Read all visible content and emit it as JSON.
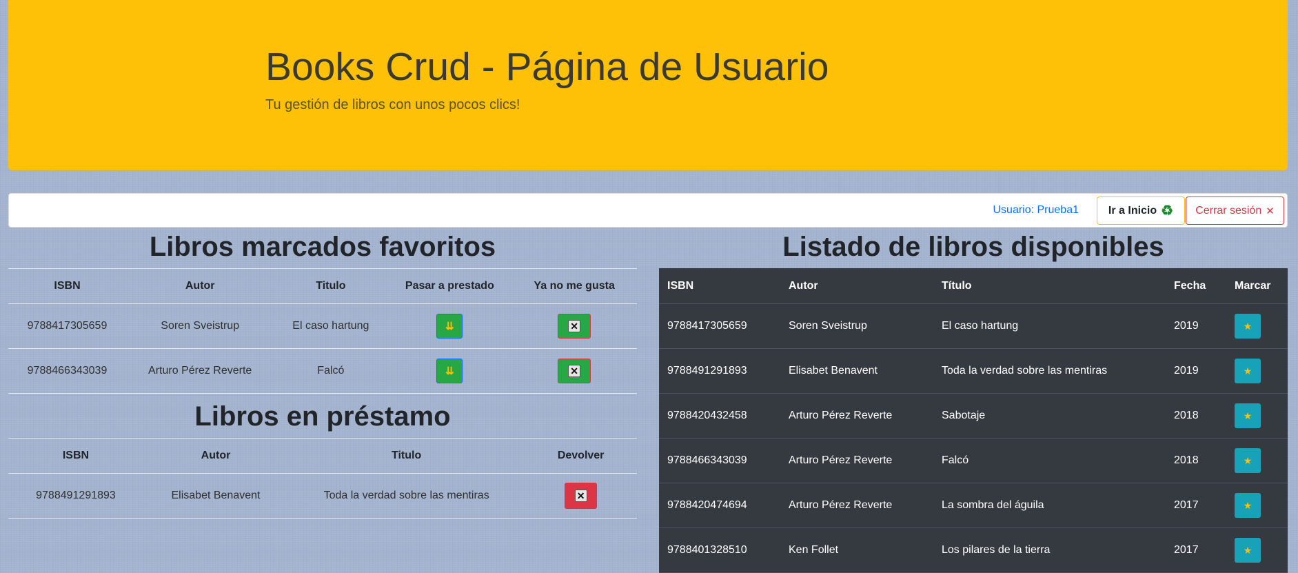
{
  "header": {
    "title": "Books Crud - Página de Usuario",
    "subtitle": "Tu gestión de libros con unos pocos clics!"
  },
  "navbar": {
    "user_label": "Usuario: Prueba1",
    "home_button": "Ir a Inicio",
    "home_icon": "♻",
    "logout_button": "Cerrar sesión",
    "logout_icon": "✕"
  },
  "favorites": {
    "title": "Libros marcados favoritos",
    "columns": [
      "ISBN",
      "Autor",
      "Titulo",
      "Pasar a prestado",
      "Ya no me gusta"
    ],
    "rows": [
      {
        "isbn": "9788417305659",
        "autor": "Soren Sveistrup",
        "titulo": "El caso hartung"
      },
      {
        "isbn": "9788466343039",
        "autor": "Arturo Pérez Reverte",
        "titulo": "Falcó"
      }
    ],
    "lend_icon": "⇊",
    "remove_icon": "✕"
  },
  "loans": {
    "title": "Libros en préstamo",
    "columns": [
      "ISBN",
      "Autor",
      "Titulo",
      "Devolver"
    ],
    "rows": [
      {
        "isbn": "9788491291893",
        "autor": "Elisabet Benavent",
        "titulo": "Toda la verdad sobre las mentiras"
      }
    ],
    "return_icon": "✕"
  },
  "available": {
    "title": "Listado de libros disponibles",
    "columns": [
      "ISBN",
      "Autor",
      "Título",
      "Fecha",
      "Marcar"
    ],
    "rows": [
      {
        "isbn": "9788417305659",
        "autor": "Soren Sveistrup",
        "titulo": "El caso hartung",
        "fecha": "2019"
      },
      {
        "isbn": "9788491291893",
        "autor": "Elisabet Benavent",
        "titulo": "Toda la verdad sobre las mentiras",
        "fecha": "2019"
      },
      {
        "isbn": "9788420432458",
        "autor": "Arturo Pérez Reverte",
        "titulo": "Sabotaje",
        "fecha": "2018"
      },
      {
        "isbn": "9788466343039",
        "autor": "Arturo Pérez Reverte",
        "titulo": "Falcó",
        "fecha": "2018"
      },
      {
        "isbn": "9788420474694",
        "autor": "Arturo Pérez Reverte",
        "titulo": "La sombra del águila",
        "fecha": "2017"
      },
      {
        "isbn": "9788401328510",
        "autor": "Ken Follet",
        "titulo": "Los pilares de la tierra",
        "fecha": "2017"
      }
    ],
    "star_icon": "★"
  }
}
